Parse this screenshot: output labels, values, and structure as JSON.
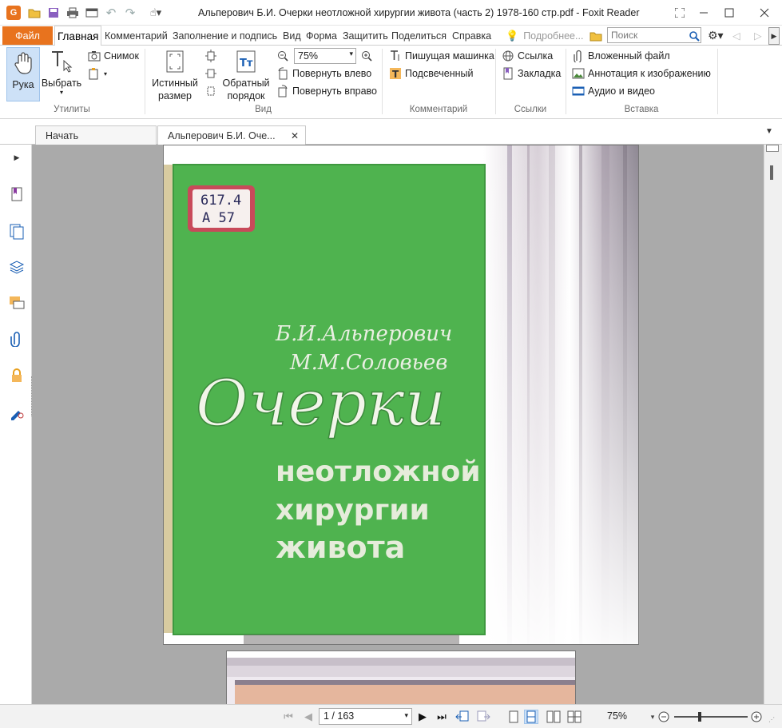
{
  "window": {
    "title": "Альперович Б.И. Очерки неотложной хирургии живота (часть 2) 1978-160 стр.pdf - Foxit Reader",
    "app_logo": "G"
  },
  "ribbon_tabs": {
    "file": "Файл",
    "items": [
      "Главная",
      "Комментарий",
      "Заполнение и подпись",
      "Вид",
      "Форма",
      "Защитить",
      "Поделиться",
      "Справка"
    ],
    "tell_me": "Подробнее...",
    "search_placeholder": "Поиск"
  },
  "ribbon": {
    "hand": "Рука",
    "select": "Выбрать",
    "snapshot": "Снимок",
    "actual_size_1": "Истинный",
    "actual_size_2": "размер",
    "reverse_1": "Обратный",
    "reverse_2": "порядок",
    "zoom_value": "75%",
    "rotate_left": "Повернуть влево",
    "rotate_right": "Повернуть вправо",
    "typewriter": "Пишущая машинка",
    "highlight": "Подсвеченный",
    "link": "Ссылка",
    "bookmark": "Закладка",
    "attachment": "Вложенный файл",
    "image_annotation": "Аннотация к изображению",
    "audio_video": "Аудио и видео",
    "groups": {
      "tools": "Утилиты",
      "view": "Вид",
      "comment": "Комментарий",
      "links": "Ссылки",
      "insert": "Вставка"
    }
  },
  "doc_tabs": {
    "start": "Начать",
    "current": "Альперович Б.И. Оче..."
  },
  "cover": {
    "label_line1": "617.4",
    "label_line2": "А 57",
    "author1": "Б.И.Альперович",
    "author2": "М.М.Соловьев",
    "title_big": "Очерки",
    "title_line2": "неотложной",
    "title_line3": "хирургии",
    "title_line4": "живота",
    "colors": {
      "cover_green": "#4fb34f",
      "spine": "#d8cba0"
    }
  },
  "statusbar": {
    "page_indicator": "1 / 163",
    "zoom": "75%"
  }
}
